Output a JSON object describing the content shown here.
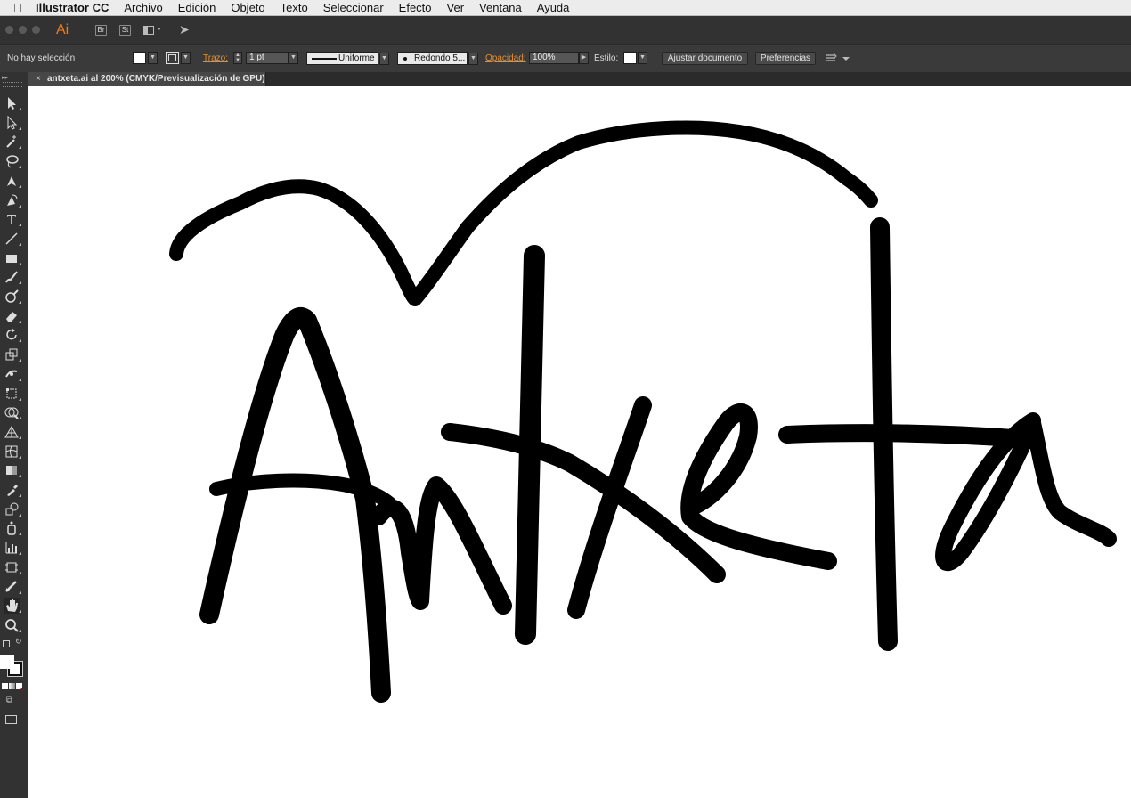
{
  "menubar": {
    "app_name": "Illustrator CC",
    "menus": [
      "Archivo",
      "Edición",
      "Objeto",
      "Texto",
      "Seleccionar",
      "Efecto",
      "Ver",
      "Ventana",
      "Ayuda"
    ]
  },
  "appbar": {
    "logo": "Ai",
    "bridge": "Br",
    "stock": "St"
  },
  "controlbar": {
    "selection_status": "No hay selección",
    "stroke_label": "Trazo:",
    "stroke_weight": "1 pt",
    "stroke_profile": "Uniforme",
    "brush": "Redondo 5...",
    "opacity_label": "Opacidad:",
    "opacity_value": "100%",
    "style_label": "Estilo:",
    "adjust_button": "Ajustar documento",
    "prefs_button": "Preferencias"
  },
  "tab": {
    "close": "×",
    "title": "antxeta.ai al 200% (CMYK/Previsualización de GPU)"
  },
  "toolbox_tools": [
    "selection-tool",
    "direct-selection-tool",
    "magic-wand-tool",
    "lasso-tool",
    "pen-tool",
    "curvature-tool",
    "type-tool",
    "line-segment-tool",
    "rectangle-tool",
    "paintbrush-tool",
    "shaper-tool",
    "eraser-tool",
    "rotate-tool",
    "scale-tool",
    "width-tool",
    "free-transform-tool",
    "shape-builder-tool",
    "perspective-grid-tool",
    "mesh-tool",
    "gradient-tool",
    "eyedropper-tool",
    "blend-tool",
    "symbol-sprayer-tool",
    "column-graph-tool",
    "artboard-tool",
    "slice-tool",
    "hand-tool",
    "zoom-tool"
  ],
  "colors": {
    "accent": "#e7902b",
    "canvas": "#ffffff",
    "ink": "#000000"
  },
  "artwork": {
    "description_text": "Antxeta"
  }
}
